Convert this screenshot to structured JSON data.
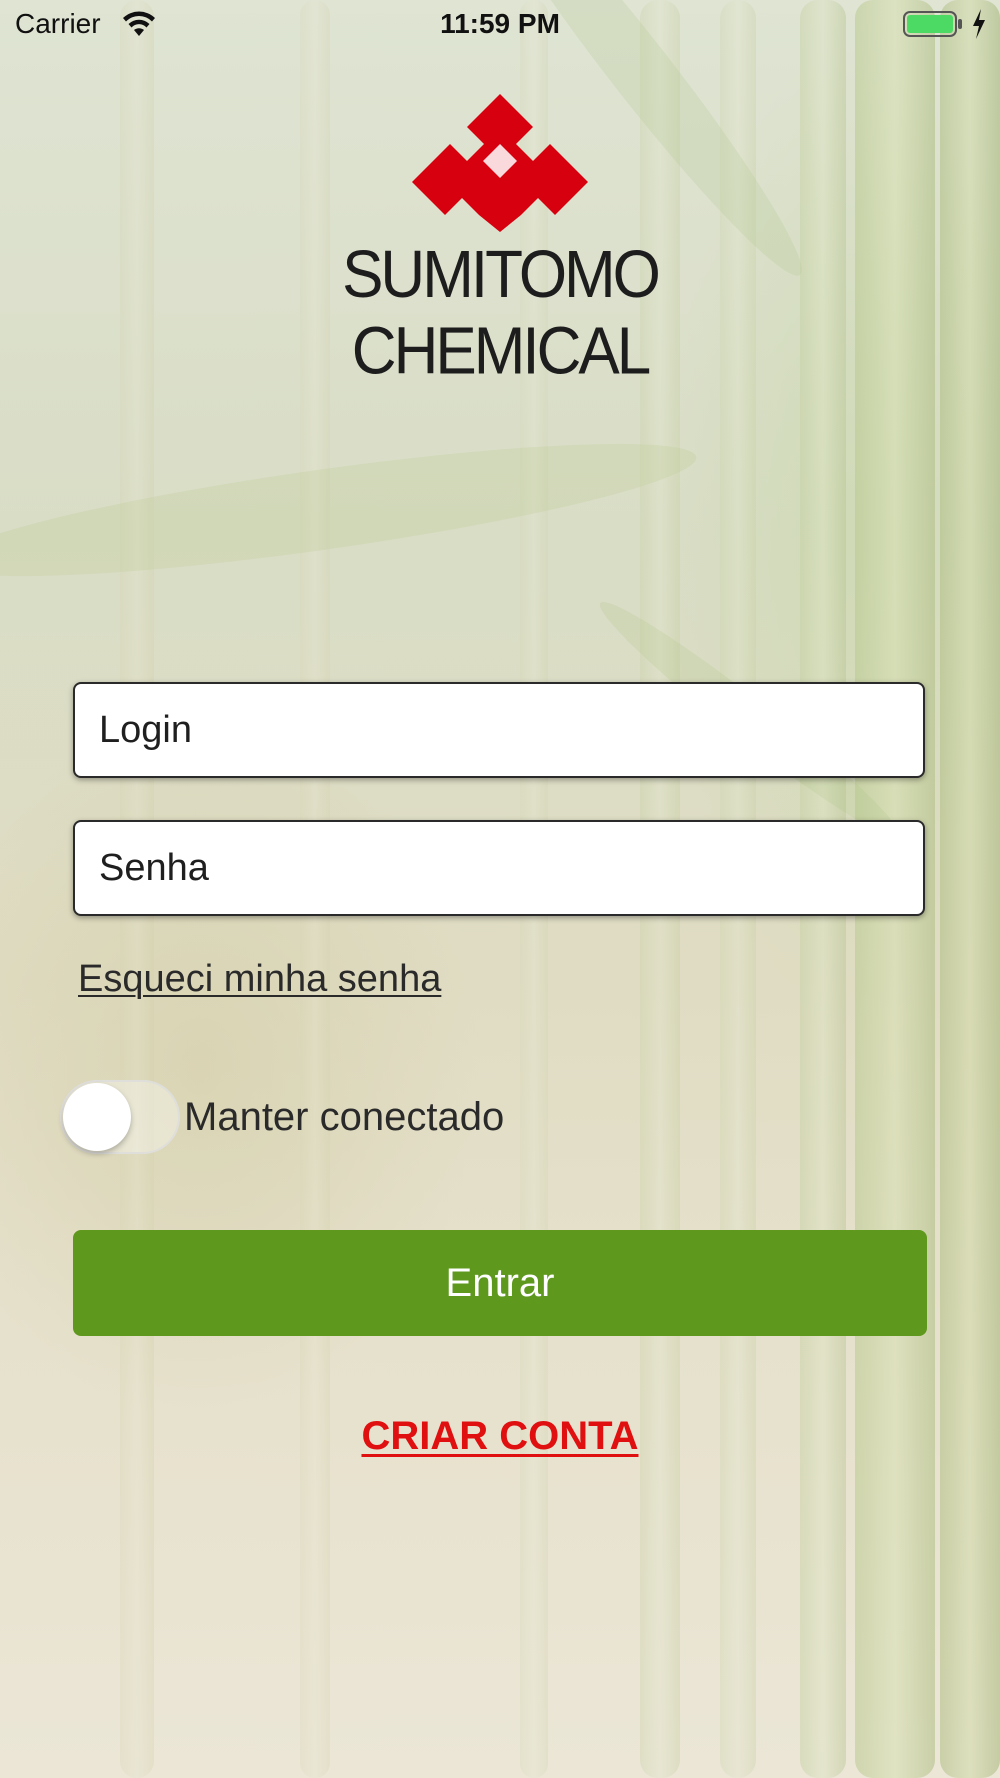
{
  "status_bar": {
    "carrier": "Carrier",
    "time": "11:59 PM",
    "wifi_icon": "wifi-icon",
    "battery_icon": "battery-icon",
    "charging_icon": "charging-bolt-icon",
    "battery_color": "#4cd964"
  },
  "logo": {
    "text": "SUMITOMO CHEMICAL",
    "mark_color": "#d6000f"
  },
  "form": {
    "login_placeholder": "Login",
    "password_placeholder": "Senha",
    "forgot_password": "Esqueci minha senha",
    "keep_connected_label": "Manter conectado",
    "keep_connected_on": false,
    "submit_label": "Entrar",
    "create_account": "CRIAR CONTA"
  },
  "colors": {
    "primary_button": "#5e981d",
    "create_account": "#e01010"
  }
}
